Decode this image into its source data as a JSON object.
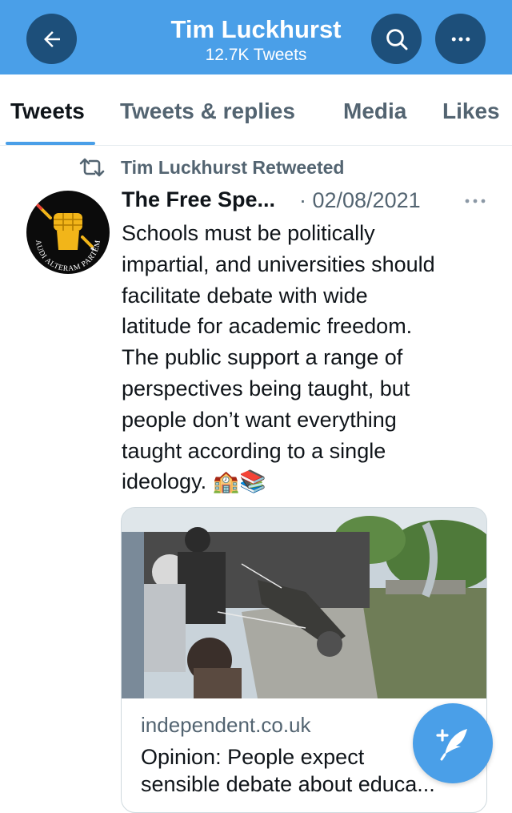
{
  "header": {
    "title": "Tim Luckhurst",
    "subtitle": "12.7K Tweets",
    "back_icon": "arrow-left-icon",
    "search_icon": "search-icon",
    "more_icon": "more-horizontal-icon"
  },
  "tabs": [
    {
      "label": "Tweets",
      "active": true
    },
    {
      "label": "Tweets & replies",
      "active": false
    },
    {
      "label": "Media",
      "active": false
    },
    {
      "label": "Likes",
      "active": false
    }
  ],
  "tweet": {
    "retweet_label": "Tim Luckhurst Retweeted",
    "author_name": "The Free Spe...",
    "date": "· 02/08/2021",
    "avatar_text": "AUDI ALTERAM PARTEM",
    "body": "Schools must be politically\nimpartial, and universities should\nfacilitate debate with wide\nlatitude for academic freedom.\nThe public support a range of\nperspectives being taught, but\npeople don’t want everything\ntaught according to a single\nideology. 🏫📚",
    "card": {
      "domain": "independent.co.uk",
      "title_line1": "Opinion: People expect",
      "title_line2": "sensible debate about educa..."
    }
  },
  "fab": {
    "icon": "compose-tweet-icon"
  },
  "colors": {
    "header_bg": "#4a9fe8",
    "header_button_bg": "#1d4f7a",
    "accent": "#4a9fe8",
    "secondary_text": "#536471"
  }
}
